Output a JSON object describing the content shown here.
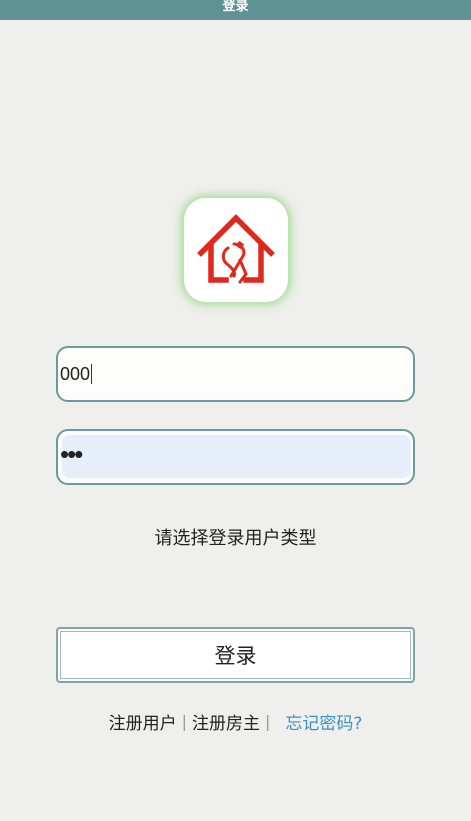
{
  "window": {
    "title": "登录",
    "titlebar_color": "#5e9294"
  },
  "logo": {
    "icon": "house-key-logo-icon",
    "color": "#e0281c",
    "glow_color": "#7cd86a"
  },
  "form": {
    "username_value": "000",
    "password_value": "•••",
    "user_type_prompt": "请选择登录用户类型",
    "login_label": "登录"
  },
  "links": {
    "register_user": "注册用户",
    "separator": "|",
    "register_landlord": "注册房主",
    "forgot_password": "忘记密码?",
    "link_color": "#3e8fc6"
  }
}
